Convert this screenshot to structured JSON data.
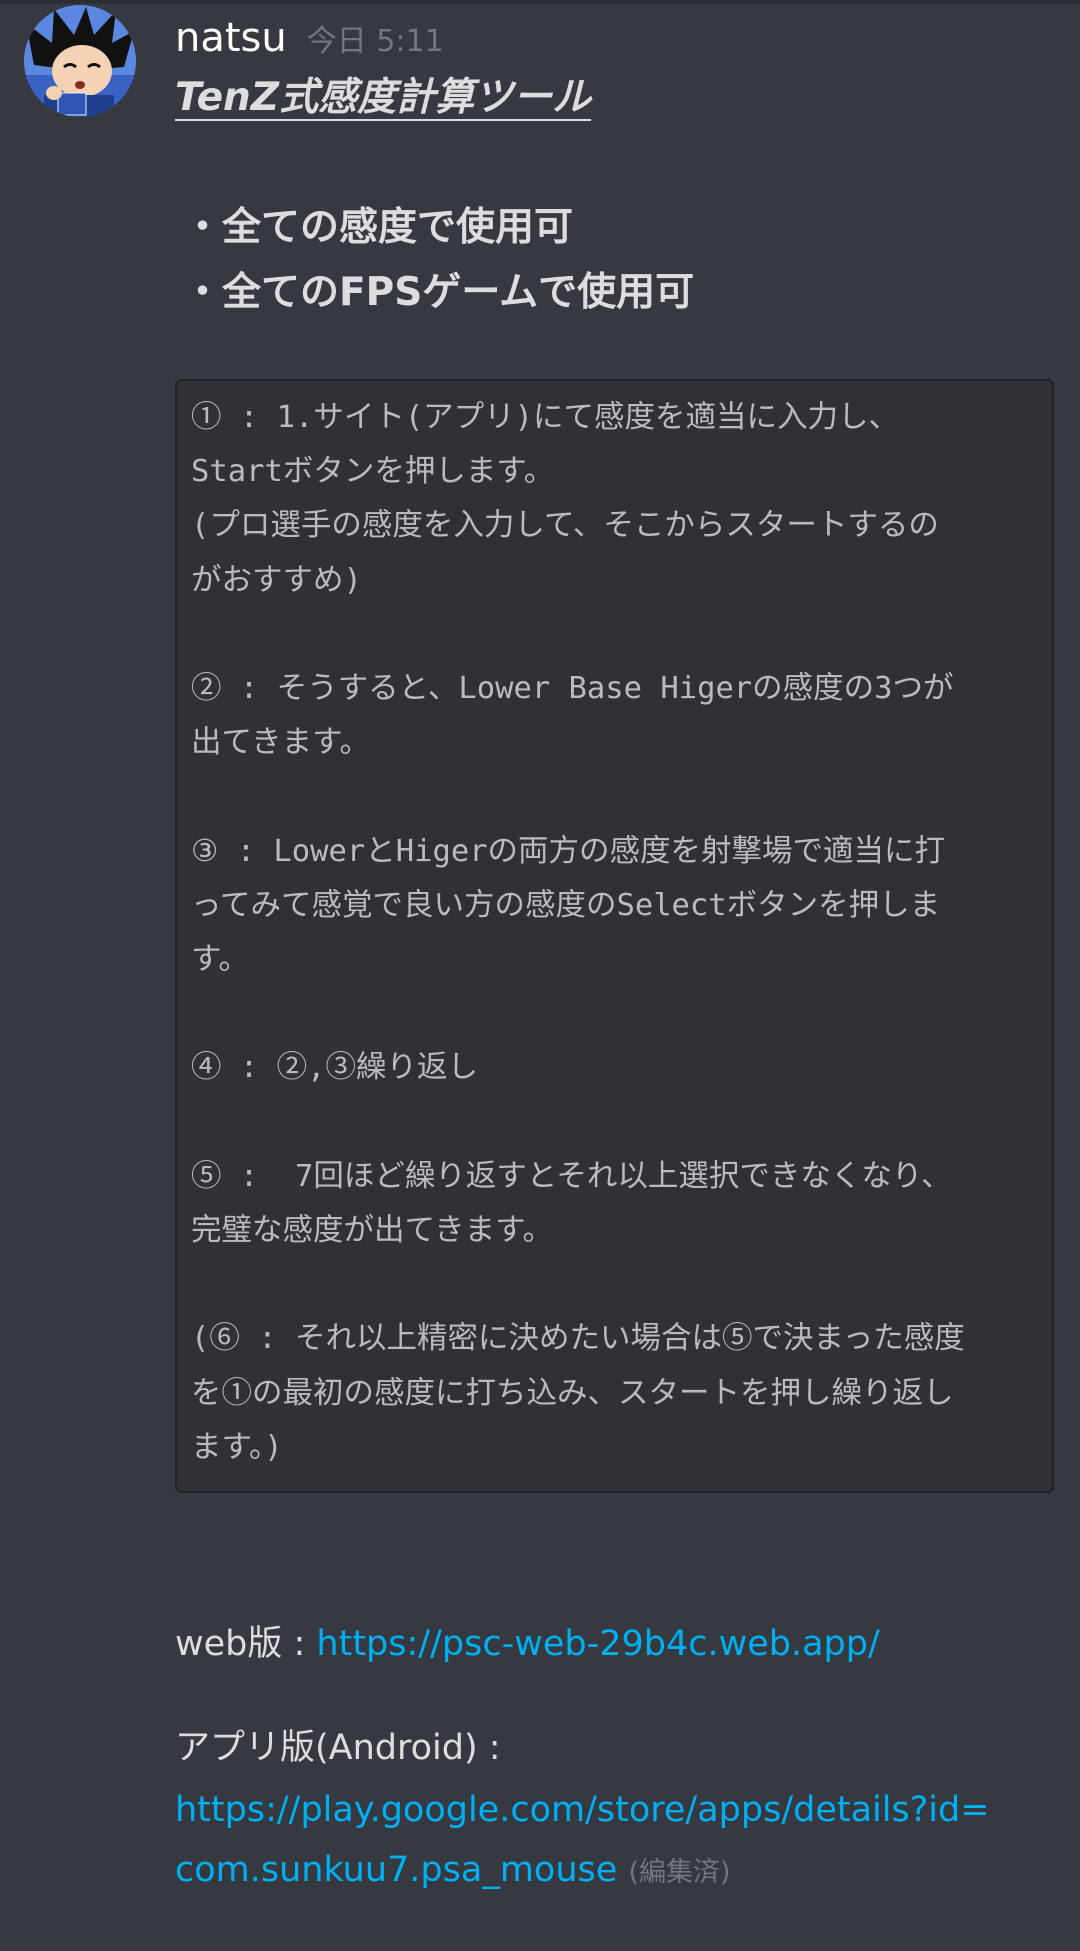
{
  "message": {
    "username": "natsu",
    "timestamp": "今日 5:11",
    "title": "TenZ式感度計算ツール",
    "bullets": [
      "・全ての感度で使用可",
      "・全てのFPSゲームで使用可"
    ],
    "code_lines": [
      "① : 1.サイト(アプリ)にて感度を適当に入力し、",
      "Startボタンを押します。",
      "(プロ選手の感度を入力して、そこからスタートするの",
      "がおすすめ)",
      "",
      "② : そうすると、Lower Base Higerの感度の3つが",
      "出てきます。",
      "",
      "③ : LowerとHigerの両方の感度を射撃場で適当に打",
      "ってみて感覚で良い方の感度のSelectボタンを押しま",
      "す。",
      "",
      "④ : ②,③繰り返し",
      "",
      "⑤ :  7回ほど繰り返すとそれ以上選択できなくなり、",
      "完璧な感度が出てきます。",
      "",
      "(⑥ : それ以上精密に決めたい場合は⑤で決まった感度",
      "を①の最初の感度に打ち込み、スタートを押し繰り返し",
      "ます。)"
    ],
    "web_label": "web版 : ",
    "web_url": "https://psc-web-29b4c.web.app/",
    "app_label": "アプリ版(Android) :",
    "app_url_line1": "https://play.google.com/store/apps/details?id=",
    "app_url_line2": "com.sunkuu7.psa_mouse",
    "edited": "(編集済)"
  },
  "avatar": {
    "icon": "anime-character-avatar-icon"
  },
  "colors": {
    "background": "#36393f",
    "codeblock_bg": "#2f3136",
    "link": "#00b0f4",
    "muted": "#72767d"
  }
}
